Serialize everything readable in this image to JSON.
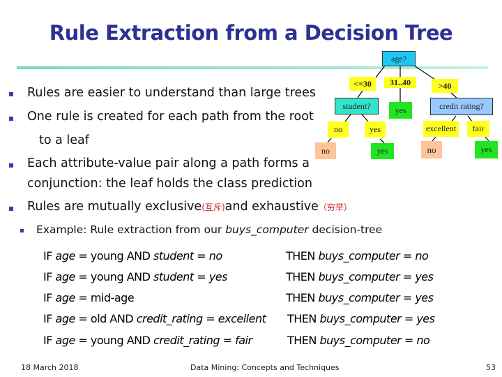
{
  "slide": {
    "title": "Rule Extraction from a Decision Tree",
    "bullets": [
      {
        "text": "Rules are easier to understand than large trees"
      },
      {
        "text": "One rule is created for each path from the root",
        "continuation": "to a leaf"
      },
      {
        "text": "Each attribute-value pair along a path forms a",
        "continuation": "conjunction: the leaf holds the class prediction"
      },
      {
        "text_before": "Rules are mutually exclusive",
        "cjk1": "(互斥)",
        "text_middle": "and exhaustive",
        "cjk2": "（穷举）"
      }
    ],
    "sub_bullet": {
      "text_before": "Example: Rule extraction from our ",
      "italic": "buys_computer",
      "text_after": " decision-tree"
    },
    "rules": [
      {
        "if_prefix": "IF ",
        "attr1": "age",
        "eq1": " = young AND ",
        "attr2": "student",
        "eq2": " = ",
        "val2": "no",
        "then": "THEN ",
        "target": "buys_computer",
        "eq3": " = ",
        "result": "no"
      },
      {
        "if_prefix": "IF ",
        "attr1": "age",
        "eq1": " = young AND ",
        "attr2": "student",
        "eq2": " = ",
        "val2": "yes",
        "then": "THEN ",
        "target": "buys_computer",
        "eq3": " = ",
        "result": "yes"
      },
      {
        "if_prefix": "IF ",
        "attr1": "age",
        "eq1": " = mid-age",
        "attr2": "",
        "eq2": "",
        "val2": "",
        "then": "THEN ",
        "target": "buys_computer",
        "eq3": " = ",
        "result": "yes"
      },
      {
        "if_prefix": "IF ",
        "attr1": "age",
        "eq1": " = old AND ",
        "attr2": "credit_rating",
        "eq2": " = ",
        "val2": "excellent",
        "then": "THEN ",
        "target": "buys_computer",
        "eq3": " = ",
        "result": "yes"
      },
      {
        "if_prefix": "IF ",
        "attr1": "age",
        "eq1": " = young AND ",
        "attr2": "credit_rating",
        "eq2": " = ",
        "val2": "fair",
        "then": "THEN ",
        "target": "buys_computer",
        "eq3": " = ",
        "result": "no"
      }
    ],
    "tree": {
      "root": "age?",
      "edges": {
        "young": "<=30",
        "mid": "31..40",
        "old": ">40",
        "stud_no": "no",
        "stud_yes": "yes",
        "cred_exc": "excellent",
        "cred_fair": "fair"
      },
      "nodes": {
        "student": "student?",
        "credit": "credit rating?",
        "leaf_mid": "yes",
        "leaf_stud_no": "no",
        "leaf_stud_yes": "yes",
        "leaf_cred_exc": "no",
        "leaf_cred_fair": "yes"
      }
    },
    "colors": {
      "title": "#2e3192",
      "bullet": "#3b3bb0",
      "cjk": "#cc2222"
    },
    "footer": {
      "date": "18 March 2018",
      "center": "Data Mining: Concepts and Techniques",
      "page": "53"
    }
  }
}
